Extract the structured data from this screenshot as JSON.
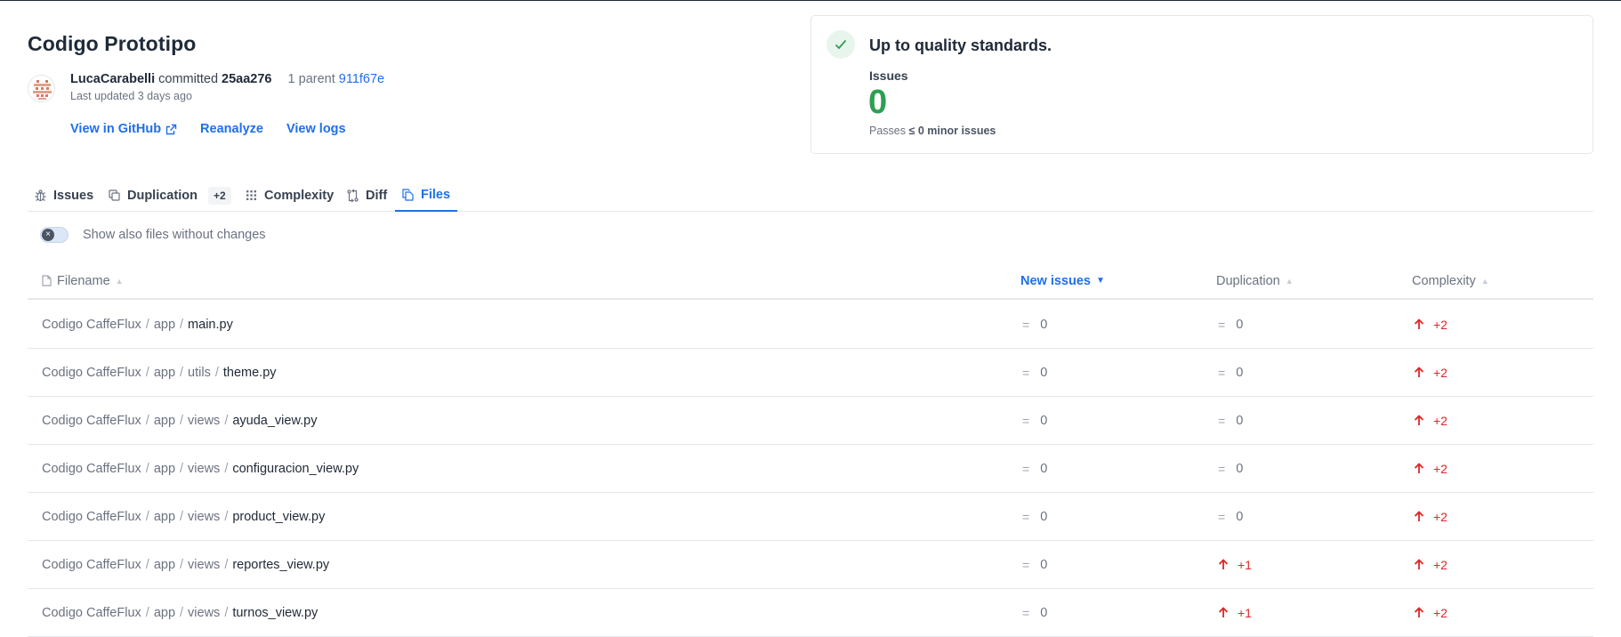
{
  "header": {
    "title": "Codigo Prototipo",
    "author": "LucaCarabelli",
    "committed_text": "committed",
    "commit_hash": "25aa276",
    "parent_text": "1 parent",
    "parent_hash": "911f67e",
    "updated": "Last updated 3 days ago",
    "actions": {
      "view_github": "View in GitHub",
      "reanalyze": "Reanalyze",
      "view_logs": "View logs"
    }
  },
  "quality": {
    "title": "Up to quality standards.",
    "issues_label": "Issues",
    "issues_count": "0",
    "passes_prefix": "Passes",
    "passes_rule": "≤ 0 minor issues"
  },
  "tabs": [
    {
      "label": "Issues",
      "icon": "bug-icon"
    },
    {
      "label": "Duplication",
      "icon": "copy-icon",
      "badge": "+2"
    },
    {
      "label": "Complexity",
      "icon": "grid-icon"
    },
    {
      "label": "Diff",
      "icon": "diff-icon"
    },
    {
      "label": "Files",
      "icon": "files-icon",
      "active": true
    }
  ],
  "toggle": {
    "label": "Show also files without changes",
    "on": false
  },
  "table": {
    "columns": {
      "filename": "Filename",
      "new_issues": "New issues",
      "duplication": "Duplication",
      "complexity": "Complexity"
    },
    "sorted_by": "new_issues",
    "rows": [
      {
        "path": [
          "Codigo CaffeFlux",
          "app"
        ],
        "file": "main.py",
        "issues": "0",
        "duplication": "0",
        "duplication_up": false,
        "complexity": "+2"
      },
      {
        "path": [
          "Codigo CaffeFlux",
          "app",
          "utils"
        ],
        "file": "theme.py",
        "issues": "0",
        "duplication": "0",
        "duplication_up": false,
        "complexity": "+2"
      },
      {
        "path": [
          "Codigo CaffeFlux",
          "app",
          "views"
        ],
        "file": "ayuda_view.py",
        "issues": "0",
        "duplication": "0",
        "duplication_up": false,
        "complexity": "+2"
      },
      {
        "path": [
          "Codigo CaffeFlux",
          "app",
          "views"
        ],
        "file": "configuracion_view.py",
        "issues": "0",
        "duplication": "0",
        "duplication_up": false,
        "complexity": "+2"
      },
      {
        "path": [
          "Codigo CaffeFlux",
          "app",
          "views"
        ],
        "file": "product_view.py",
        "issues": "0",
        "duplication": "0",
        "duplication_up": false,
        "complexity": "+2"
      },
      {
        "path": [
          "Codigo CaffeFlux",
          "app",
          "views"
        ],
        "file": "reportes_view.py",
        "issues": "0",
        "duplication": "+1",
        "duplication_up": true,
        "complexity": "+2"
      },
      {
        "path": [
          "Codigo CaffeFlux",
          "app",
          "views"
        ],
        "file": "turnos_view.py",
        "issues": "0",
        "duplication": "+1",
        "duplication_up": true,
        "complexity": "+2"
      }
    ]
  },
  "colors": {
    "accent": "#1f6feb",
    "good": "#2f9e54",
    "bad": "#dc2626"
  }
}
